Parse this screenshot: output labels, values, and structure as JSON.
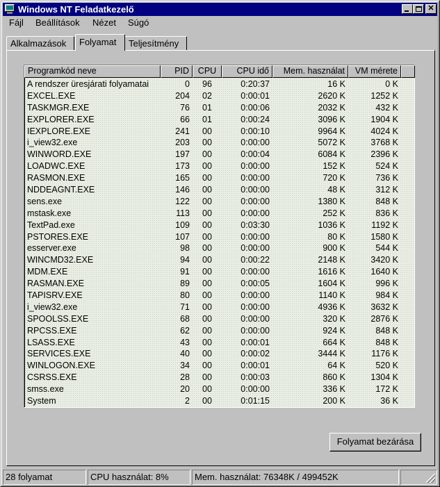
{
  "window": {
    "title": "Windows NT Feladatkezelő"
  },
  "menu": {
    "items": [
      "Fájl",
      "Beállítások",
      "Nézet",
      "Súgó"
    ]
  },
  "tabs": [
    {
      "label": "Alkalmazások",
      "active": false
    },
    {
      "label": "Folyamat",
      "active": true
    },
    {
      "label": "Teljesítmény",
      "active": false
    }
  ],
  "table": {
    "columns": [
      "Programkód neve",
      "PID",
      "CPU",
      "CPU idő",
      "Mem. használat",
      "VM mérete"
    ],
    "rows": [
      [
        "A rendszer üresjárati folyamatai",
        "0",
        "96",
        "0:20:37",
        "16 K",
        "0 K"
      ],
      [
        "EXCEL.EXE",
        "204",
        "02",
        "0:00:01",
        "2620 K",
        "1252 K"
      ],
      [
        "TASKMGR.EXE",
        "76",
        "01",
        "0:00:06",
        "2032 K",
        "432 K"
      ],
      [
        "EXPLORER.EXE",
        "66",
        "01",
        "0:00:24",
        "3096 K",
        "1904 K"
      ],
      [
        "IEXPLORE.EXE",
        "241",
        "00",
        "0:00:10",
        "9964 K",
        "4024 K"
      ],
      [
        "i_view32.exe",
        "203",
        "00",
        "0:00:00",
        "5072 K",
        "3768 K"
      ],
      [
        "WINWORD.EXE",
        "197",
        "00",
        "0:00:04",
        "6084 K",
        "2396 K"
      ],
      [
        "LOADWC.EXE",
        "173",
        "00",
        "0:00:00",
        "152 K",
        "524 K"
      ],
      [
        "RASMON.EXE",
        "165",
        "00",
        "0:00:00",
        "720 K",
        "736 K"
      ],
      [
        "NDDEAGNT.EXE",
        "146",
        "00",
        "0:00:00",
        "48 K",
        "312 K"
      ],
      [
        "sens.exe",
        "122",
        "00",
        "0:00:00",
        "1380 K",
        "848 K"
      ],
      [
        "mstask.exe",
        "113",
        "00",
        "0:00:00",
        "252 K",
        "836 K"
      ],
      [
        "TextPad.exe",
        "109",
        "00",
        "0:03:30",
        "1036 K",
        "1192 K"
      ],
      [
        "PSTORES.EXE",
        "107",
        "00",
        "0:00:00",
        "80 K",
        "1580 K"
      ],
      [
        "esserver.exe",
        "98",
        "00",
        "0:00:00",
        "900 K",
        "544 K"
      ],
      [
        "WINCMD32.EXE",
        "94",
        "00",
        "0:00:22",
        "2148 K",
        "3420 K"
      ],
      [
        "MDM.EXE",
        "91",
        "00",
        "0:00:00",
        "1616 K",
        "1640 K"
      ],
      [
        "RASMAN.EXE",
        "89",
        "00",
        "0:00:05",
        "1604 K",
        "996 K"
      ],
      [
        "TAPISRV.EXE",
        "80",
        "00",
        "0:00:00",
        "1140 K",
        "984 K"
      ],
      [
        "i_view32.exe",
        "71",
        "00",
        "0:00:00",
        "4936 K",
        "3632 K"
      ],
      [
        "SPOOLSS.EXE",
        "68",
        "00",
        "0:00:00",
        "320 K",
        "2876 K"
      ],
      [
        "RPCSS.EXE",
        "62",
        "00",
        "0:00:00",
        "924 K",
        "848 K"
      ],
      [
        "LSASS.EXE",
        "43",
        "00",
        "0:00:01",
        "664 K",
        "848 K"
      ],
      [
        "SERVICES.EXE",
        "40",
        "00",
        "0:00:02",
        "3444 K",
        "1176 K"
      ],
      [
        "WINLOGON.EXE",
        "34",
        "00",
        "0:00:01",
        "64 K",
        "520 K"
      ],
      [
        "CSRSS.EXE",
        "28",
        "00",
        "0:00:03",
        "860 K",
        "1304 K"
      ],
      [
        "smss.exe",
        "20",
        "00",
        "0:00:00",
        "336 K",
        "172 K"
      ],
      [
        "System",
        "2",
        "00",
        "0:01:15",
        "200 K",
        "36 K"
      ]
    ]
  },
  "end_button": {
    "label": "Folyamat bezárása"
  },
  "status": {
    "process_count": "28 folyamat",
    "cpu_usage": "CPU használat: 8%",
    "mem_usage": "Mem. használat: 76348K / 499452K"
  },
  "icons": {
    "app": "monitor-icon",
    "minimize": "minimize-icon",
    "maximize": "maximize-icon",
    "close": "close-icon",
    "grip": "resize-grip-icon"
  },
  "colors": {
    "titlebar": "#000080",
    "face": "#c0c0c0",
    "list_background": "#e9eee4"
  }
}
